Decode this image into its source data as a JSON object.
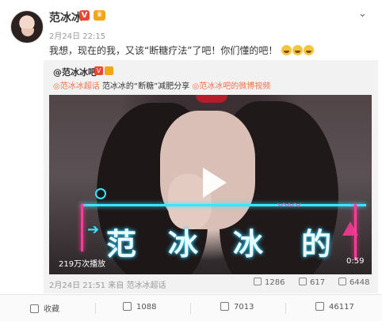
{
  "post": {
    "author": "范冰冰",
    "time": "2月24日 22:15",
    "text": "我想，现在的我，又该“断糖疗法”了吧！你们懂的吧！"
  },
  "repost": {
    "author": "@范冰冰吧",
    "tag_supertopic": "范冰冰超话",
    "tag_text": "范冰冰的“断糖”减肥分享",
    "tag_video": "范冰冰吧的微博视频",
    "video_chars": [
      "范",
      "冰",
      "冰",
      "的"
    ],
    "plays": "219万次播放",
    "duration": "0:59",
    "meta": "2月24日 21:51 来自 范冰冰超话",
    "forward_count": "1286",
    "comment_count": "617",
    "like_count": "6448"
  },
  "bottom_bar": {
    "favorite": "收藏",
    "forward": "1088",
    "comment": "7013",
    "like": "46117"
  },
  "colors": {
    "link": "#eb7350",
    "verified": "#e8492e"
  },
  "icons": [
    "chevron-down-icon",
    "verified-icon",
    "crown-icon",
    "play-icon",
    "forward-icon",
    "comment-icon",
    "like-icon",
    "star-icon"
  ]
}
